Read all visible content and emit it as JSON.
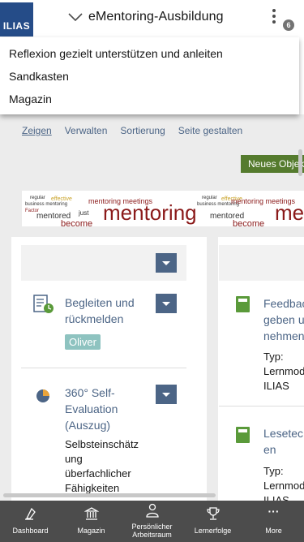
{
  "header": {
    "logo_text": "ILIAS",
    "title": "eMentoring-Ausbildung",
    "notification_count": "6"
  },
  "dropdown": {
    "items": [
      {
        "label": "Reflexion gezielt unterstützen und anleiten"
      },
      {
        "label": "Sandkasten"
      },
      {
        "label": "Magazin"
      }
    ]
  },
  "tabs": [
    {
      "label": "Zeigen",
      "active": true
    },
    {
      "label": "Verwalten"
    },
    {
      "label": "Sortierung"
    },
    {
      "label": "Seite gestalten"
    }
  ],
  "new_object_button": "Neues Objekt",
  "banner": {
    "image_text": [
      "mentoring",
      "mentor",
      "mentored",
      "mentoring meetings",
      "effective",
      "business mentoring",
      "become",
      "regular",
      "Factor",
      "just"
    ]
  },
  "left_column": {
    "items": [
      {
        "icon": "survey-clock-icon",
        "title_lines": [
          "Begleiten und",
          "rückmelden"
        ],
        "tag": "Oliver"
      },
      {
        "icon": "pie-chart-icon",
        "title_lines": [
          "360° Self-",
          "Evaluation",
          "(Auszug)"
        ],
        "description_lines": [
          "Selbsteinschätz",
          "ung",
          "überfachlicher",
          "Fähigkeiten"
        ]
      }
    ]
  },
  "right_column": {
    "items": [
      {
        "icon": "learning-module-icon",
        "title_lines": [
          "Feedbac",
          "geben u",
          "nehmen"
        ],
        "type_label": "Typ:",
        "type_lines": [
          "Lernmod",
          "ILIAS"
        ]
      },
      {
        "icon": "learning-module-icon",
        "title_lines": [
          "Lesetec",
          "en"
        ],
        "type_label": "Typ:",
        "type_lines": [
          "Lernmod",
          "ILIAS"
        ]
      }
    ]
  },
  "footer": {
    "items": [
      {
        "icon": "dashboard-icon",
        "label_lines": [
          "Dashboard"
        ]
      },
      {
        "icon": "magazin-icon",
        "label_lines": [
          "Magazin"
        ]
      },
      {
        "icon": "person-icon",
        "label_lines": [
          "Persönlicher",
          "Arbeitsraum"
        ]
      },
      {
        "icon": "trophy-icon",
        "label_lines": [
          "Lernerfolge"
        ]
      },
      {
        "icon": "more-icon",
        "label_lines": [
          "More"
        ]
      }
    ],
    "more_glyph": "···"
  },
  "colors": {
    "brand": "#254c88",
    "link": "#4c6586",
    "primary_button": "#557b2e",
    "tag": "#8ec3c0",
    "footer": "#4c4c4c",
    "module_green": "#5a9a3a",
    "banner_red": "#8b1a1a"
  }
}
